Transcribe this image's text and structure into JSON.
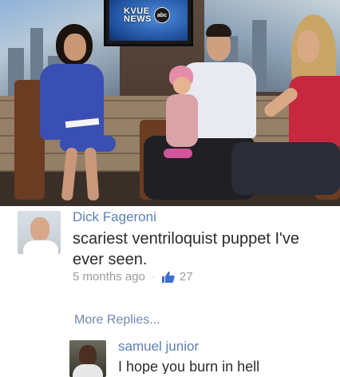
{
  "image": {
    "tv_logo": {
      "line1": "KVUE",
      "line2": "NEWS",
      "network": "abc"
    }
  },
  "comments": [
    {
      "author": "Dick Fageroni",
      "text": "scariest ventriloquist puppet I've ever seen.",
      "time": "5 months ago",
      "likes": "27"
    }
  ],
  "more_replies_label": "More Replies...",
  "reply": {
    "author": "samuel junior",
    "text": "I hope you burn in hell"
  },
  "colors": {
    "author_link": "#5b7fb7",
    "like_icon": "#3f6fd0",
    "meta_text": "#9b9b9b"
  },
  "icons": {
    "like": "thumbs-up-icon"
  }
}
